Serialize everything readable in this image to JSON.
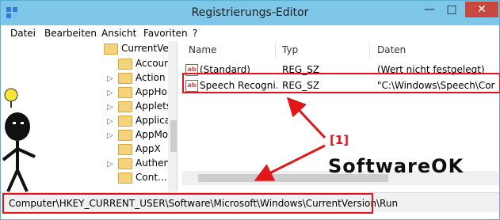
{
  "window": {
    "title": "Registrierungs-Editor",
    "controls": {
      "minimize": "—",
      "maximize": "□",
      "close": "✕"
    }
  },
  "menu": [
    "Datei",
    "Bearbeiten",
    "Ansicht",
    "Favoriten",
    "?"
  ],
  "tree": {
    "root": "CurrentVersion",
    "root_truncated": "CurrentVer",
    "items": [
      "Accoun",
      "Action",
      "AppHo",
      "Applets",
      "Applica",
      "AppMo",
      "AppX",
      "Authen",
      "Cont..."
    ]
  },
  "list": {
    "columns": [
      "Name",
      "Typ",
      "Daten"
    ],
    "rows": [
      {
        "name": "(Standard)",
        "type": "REG_SZ",
        "data": "(Wert nicht festgelegt)"
      },
      {
        "name": "Speech Recogni...",
        "type": "REG_SZ",
        "data": "\"C:\\Windows\\Speech\\Cor"
      }
    ]
  },
  "status": {
    "path": "Computer\\HKEY_CURRENT_USER\\Software\\Microsoft\\Windows\\CurrentVersion\\Run"
  },
  "annotation": {
    "label": "[1]",
    "brand": "SoftwareOK"
  },
  "colors": {
    "titlebar": "#7ec7e8",
    "highlight": "#e0161a",
    "folder": "#f5d37a"
  }
}
